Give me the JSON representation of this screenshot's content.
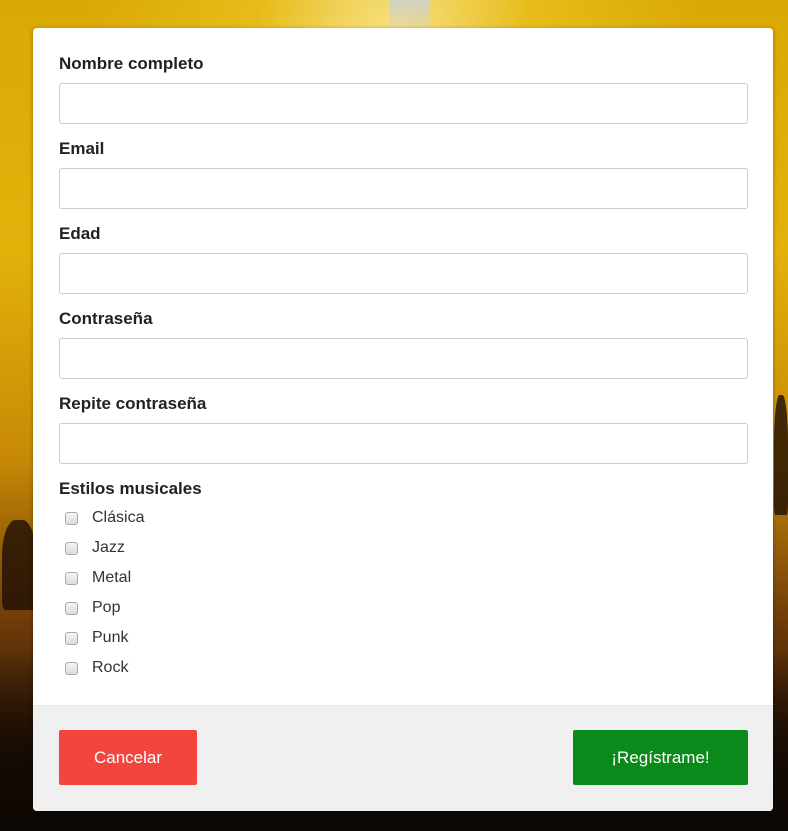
{
  "form": {
    "fields": [
      {
        "label": "Nombre completo",
        "value": "",
        "type": "text"
      },
      {
        "label": "Email",
        "value": "",
        "type": "email"
      },
      {
        "label": "Edad",
        "value": "",
        "type": "text"
      },
      {
        "label": "Contraseña",
        "value": "",
        "type": "password"
      },
      {
        "label": "Repite contraseña",
        "value": "",
        "type": "password"
      }
    ],
    "styles_label": "Estilos musicales",
    "styles": [
      {
        "label": "Clásica",
        "checked": false
      },
      {
        "label": "Jazz",
        "checked": false
      },
      {
        "label": "Metal",
        "checked": false
      },
      {
        "label": "Pop",
        "checked": false
      },
      {
        "label": "Punk",
        "checked": false
      },
      {
        "label": "Rock",
        "checked": false
      }
    ]
  },
  "footer": {
    "cancel_label": "Cancelar",
    "submit_label": "¡Regístrame!"
  },
  "colors": {
    "cancel": "#f1453d",
    "submit": "#0a8a1a",
    "background_accent": "#e3b10a"
  }
}
